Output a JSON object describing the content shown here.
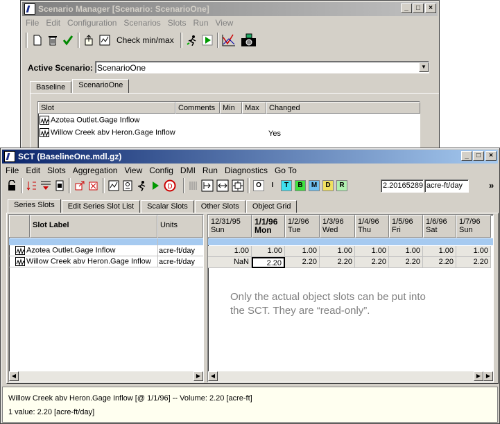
{
  "scenario_manager": {
    "title": "Scenario Manager [Scenario: ScenarioOne]",
    "menu": [
      "File",
      "Edit",
      "Configuration",
      "Scenarios",
      "Slots",
      "Run",
      "View"
    ],
    "check_label": "Check min/max",
    "active_label": "Active Scenario:",
    "active_value": "ScenarioOne",
    "tabs": [
      "Baseline",
      "ScenarioOne"
    ],
    "columns": [
      "Slot",
      "Comments",
      "Min",
      "Max",
      "Changed"
    ],
    "rows": [
      {
        "slot": "Azotea Outlet.Gage Inflow",
        "changed": ""
      },
      {
        "slot": "Willow Creek abv Heron.Gage Inflow",
        "changed": "Yes"
      }
    ]
  },
  "sct": {
    "title": "SCT  (BaselineOne.mdl.gz)",
    "menu": [
      "File",
      "Edit",
      "Slots",
      "Aggregation",
      "View",
      "Config",
      "DMI",
      "Run",
      "Diagnostics",
      "Go To"
    ],
    "letter_buttons": [
      "O",
      "I",
      "T",
      "B",
      "M",
      "D",
      "R"
    ],
    "value_field": "2.20165289",
    "units_field": "acre-ft/day",
    "more": "»",
    "tabs": [
      "Series Slots",
      "Edit Series Slot List",
      "Scalar Slots",
      "Other Slots",
      "Object Grid"
    ],
    "slot_label_header": "Slot Label",
    "units_header": "Units",
    "dates": [
      {
        "date": "12/31/95",
        "day": "Sun"
      },
      {
        "date": "1/1/96",
        "day": "Mon"
      },
      {
        "date": "1/2/96",
        "day": "Tue"
      },
      {
        "date": "1/3/96",
        "day": "Wed"
      },
      {
        "date": "1/4/96",
        "day": "Thu"
      },
      {
        "date": "1/5/96",
        "day": "Fri"
      },
      {
        "date": "1/6/96",
        "day": "Sat"
      },
      {
        "date": "1/7/96",
        "day": "Sun"
      }
    ],
    "rows": [
      {
        "label": "Azotea Outlet.Gage Inflow",
        "units": "acre-ft/day",
        "values": [
          "1.00",
          "1.00",
          "1.00",
          "1.00",
          "1.00",
          "1.00",
          "1.00",
          "1.00"
        ]
      },
      {
        "label": "Willow Creek abv Heron.Gage Inflow",
        "units": "acre-ft/day",
        "values": [
          "NaN",
          "2.20",
          "2.20",
          "2.20",
          "2.20",
          "2.20",
          "2.20",
          "2.20"
        ]
      }
    ],
    "note_line1": "Only the actual object slots can be put into",
    "note_line2": "the SCT.  They are “read-only”.",
    "status_line1": "Willow Creek abv Heron.Gage Inflow [@ 1/1/96] -- Volume: 2.20 [acre-ft]",
    "status_line2": "1 value:  2.20 [acre-ft/day]"
  },
  "colors": {
    "title_active": "#0a246a",
    "selection": "#a6caf0",
    "note": "#808080"
  }
}
